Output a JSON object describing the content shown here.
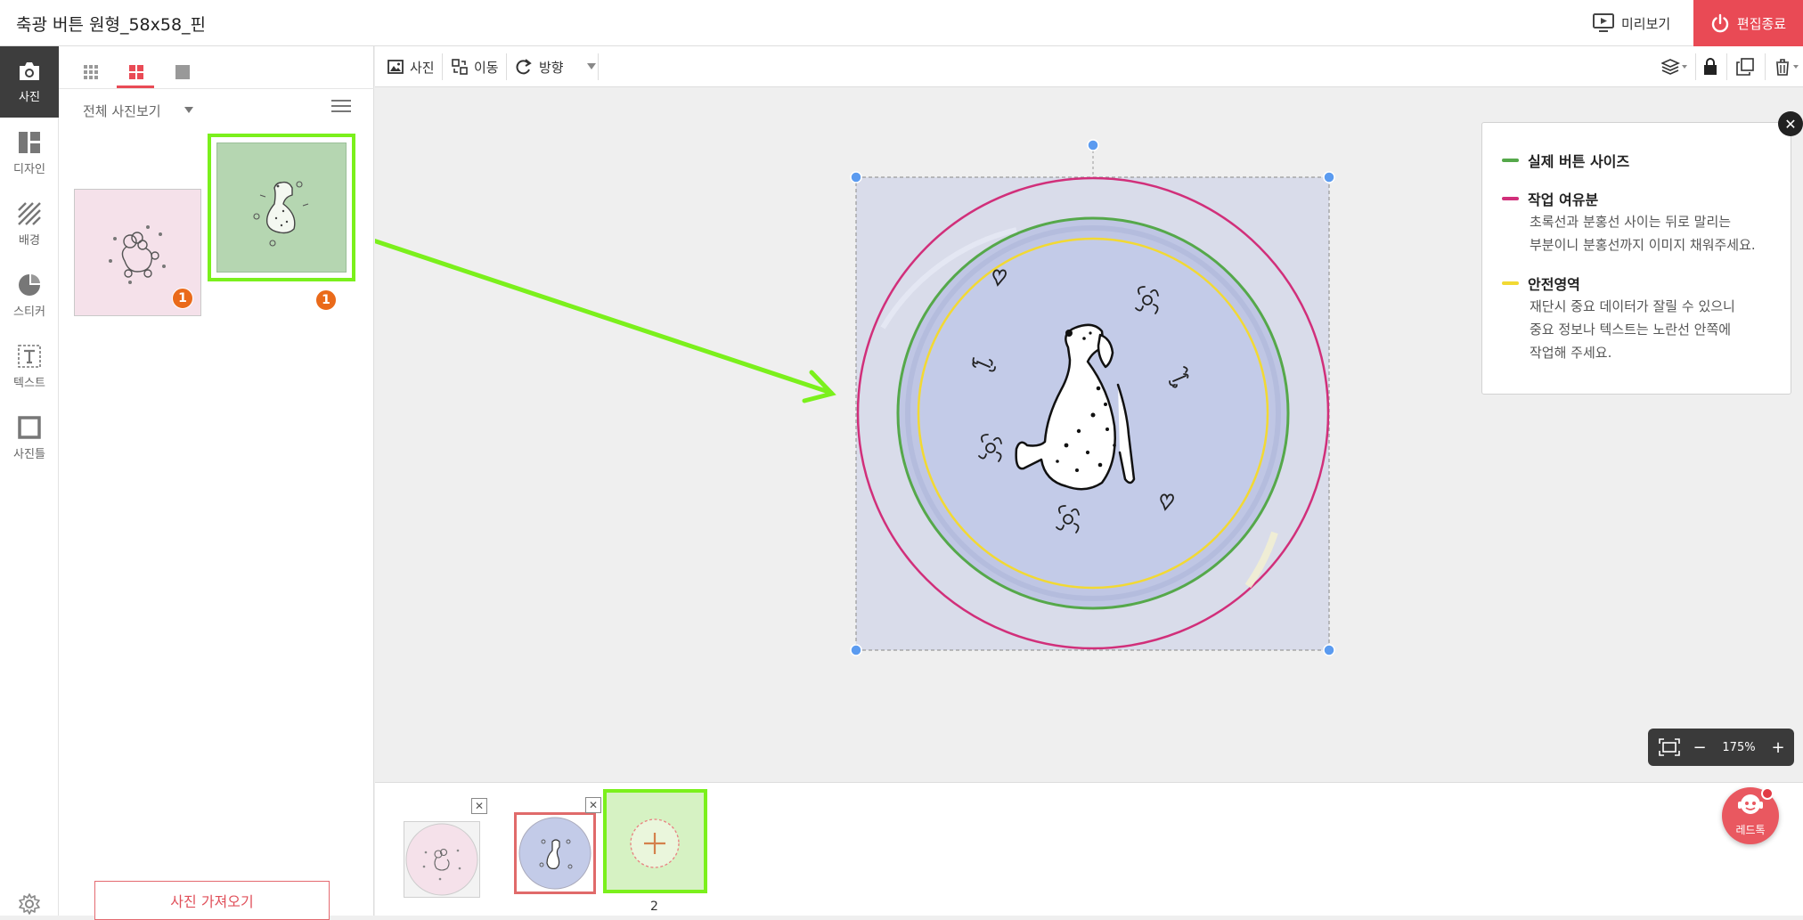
{
  "header": {
    "title": "축광 버튼 원형_58x58_핀",
    "preview_label": "미리보기",
    "exit_label": "편집종료"
  },
  "rail": {
    "items": [
      {
        "label": "사진",
        "icon": "camera-icon"
      },
      {
        "label": "디자인",
        "icon": "layout-icon"
      },
      {
        "label": "배경",
        "icon": "hatch-icon"
      },
      {
        "label": "스티커",
        "icon": "sticker-icon"
      },
      {
        "label": "텍스트",
        "icon": "text-icon"
      },
      {
        "label": "사진틀",
        "icon": "frame-icon"
      }
    ],
    "settings_icon": "gear-icon"
  },
  "panel": {
    "filter_label": "전체 사진보기",
    "photos": [
      {
        "bg": "#f5e1ea",
        "badge": "1",
        "selected": false
      },
      {
        "bg": "#b5d6b1",
        "badge": "1",
        "selected": true
      }
    ],
    "import_label": "사진 가져오기"
  },
  "toolbar": {
    "photo_label": "사진",
    "move_label": "이동",
    "direction_label": "방향"
  },
  "legend": {
    "items": [
      {
        "title": "실제 버튼 사이즈",
        "color": "#55a84a",
        "desc": ""
      },
      {
        "title": "작업 여유분",
        "color": "#d12f7a",
        "desc": "초록선과 분홍선 사이는 뒤로 말리는\n부분이니 분홍선까지 이미지 채워주세요."
      },
      {
        "title": "안전영역",
        "color": "#f2d933",
        "desc": "재단시 중요 데이터가 잘릴 수 있으니\n중요 정보나 텍스트는 노란선 안쪽에\n작업해 주세요."
      }
    ]
  },
  "zoom": {
    "level": "175%",
    "minus": "−",
    "plus": "+"
  },
  "pages": {
    "count_label": "2",
    "thumbs": [
      {
        "bg": "#f5e1ea",
        "selected": false
      },
      {
        "bg": "#c3cbe8",
        "selected": true
      }
    ]
  },
  "chat": {
    "label": "레드톡"
  },
  "colors": {
    "accent": "#e94a55",
    "highlight": "#7bf01c",
    "canvas_outer": "#d9dcea",
    "canvas_inner": "#c3cbe8"
  }
}
